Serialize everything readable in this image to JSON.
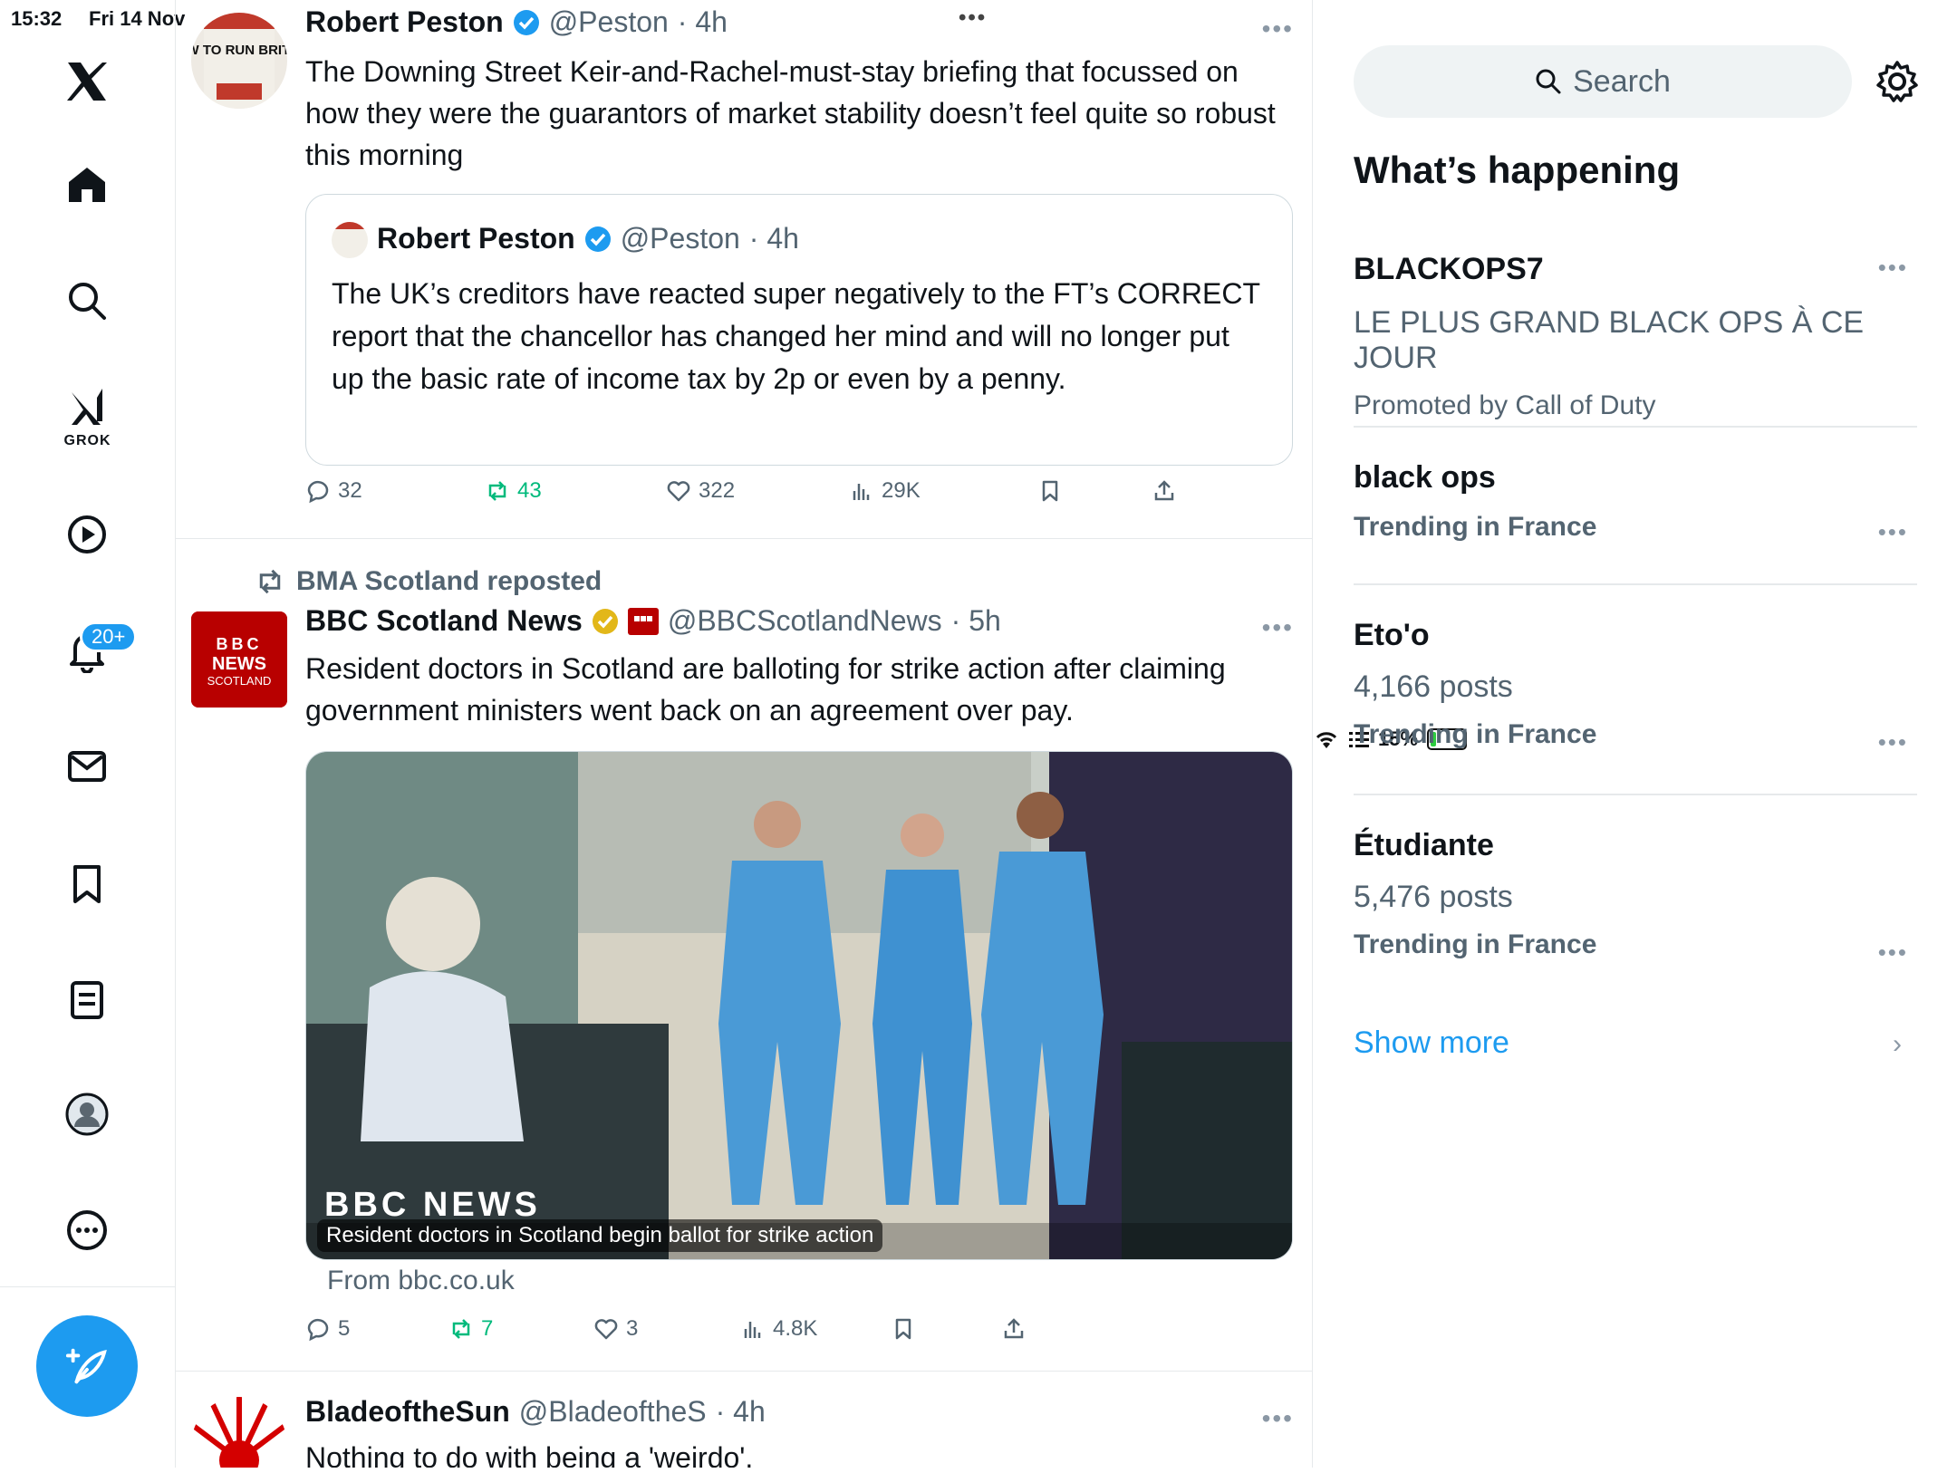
{
  "status": {
    "time": "15:32",
    "date": "Fri 14 Nov",
    "battery": "15%"
  },
  "nav": {
    "grok_label": "GROK",
    "notifications_badge": "20+"
  },
  "tweets": [
    {
      "name": "Robert Peston",
      "handle": "@Peston",
      "time": "· 4h",
      "text": "The Downing Street Keir-and-Rachel-must-stay briefing that focussed on how they were the guarantors of market stability doesn’t feel quite so robust this morning",
      "quote": {
        "name": "Robert Peston",
        "handle": "@Peston",
        "time": "· 4h",
        "text": "The UK’s creditors have reacted super negatively to the FT’s CORRECT report that the chancellor has changed her mind and will no longer put up the basic rate of income tax by 2p or even by a penny."
      },
      "replies": "32",
      "reposts": "43",
      "likes": "322",
      "views": "29K"
    },
    {
      "reposted_by": "BMA Scotland reposted",
      "name": "BBC Scotland News",
      "handle": "@BBCScotlandNews",
      "time": "· 5h",
      "text": "Resident doctors in Scotland are balloting for strike action after claiming government ministers went back on an agreement over pay.",
      "card_caption": "Resident doctors in Scotland begin ballot for strike action",
      "card_watermark": "BBC NEWS",
      "card_source": "From bbc.co.uk",
      "replies": "5",
      "reposts": "7",
      "likes": "3",
      "views": "4.8K"
    },
    {
      "name": "BladeoftheSun",
      "handle": "@BladeoftheS",
      "time": "· 4h",
      "text": "Nothing to do with being a 'weirdo'."
    }
  ],
  "avatars": {
    "peston_book": "HOW TO RUN BRITAIN",
    "bbc_logo": "BBC",
    "bbc_logo_line2": "NEWS",
    "bbc_logo_line3": "SCOTLAND"
  },
  "sidebar": {
    "search_placeholder": "Search",
    "title": "What’s happening",
    "trends": [
      {
        "title": "BLACKOPS7",
        "subtitle": "LE PLUS GRAND BLACK OPS À CE JOUR",
        "meta": "Promoted by Call of Duty"
      },
      {
        "title": "black ops",
        "meta": "Trending in France"
      },
      {
        "title": "Eto'o",
        "subtitle": "4,166 posts",
        "meta": "Trending in France"
      },
      {
        "title": "Étudiante",
        "subtitle": "5,476 posts",
        "meta": "Trending in France"
      }
    ],
    "show_more": "Show more"
  },
  "colors": {
    "accent": "#1d9bf0",
    "repost_green": "#00ba7c",
    "bbc_red": "#b80000",
    "verified_gold": "#e2b719"
  }
}
